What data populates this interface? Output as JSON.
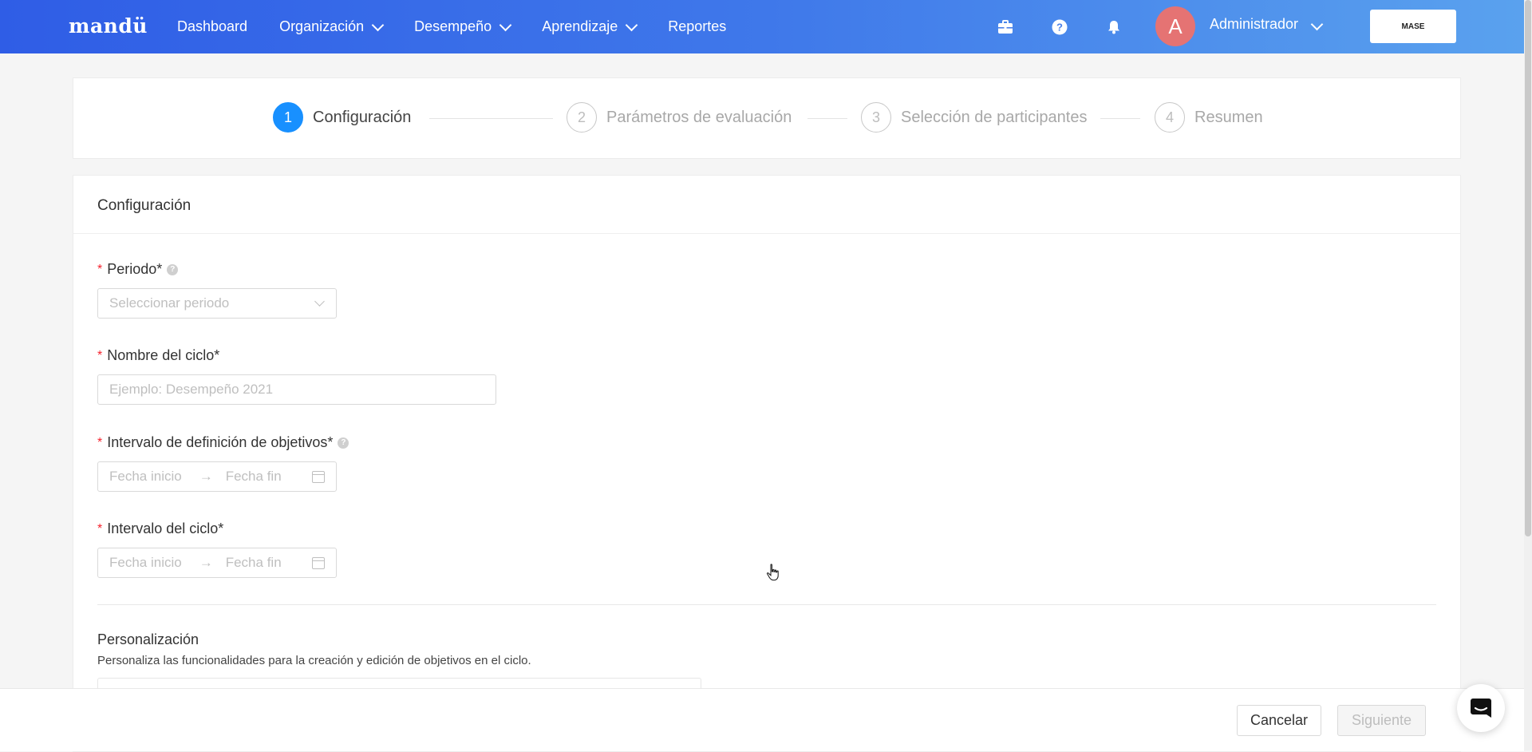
{
  "app": {
    "logo": "mandü",
    "company_logo": "MASE"
  },
  "nav": {
    "items": [
      {
        "label": "Dashboard",
        "has_dropdown": false
      },
      {
        "label": "Organización",
        "has_dropdown": true
      },
      {
        "label": "Desempeño",
        "has_dropdown": true
      },
      {
        "label": "Aprendizaje",
        "has_dropdown": true
      },
      {
        "label": "Reportes",
        "has_dropdown": false
      }
    ],
    "icons": [
      "briefcase-icon",
      "help-icon",
      "bell-icon"
    ],
    "user": {
      "initial": "A",
      "name": "Administrador"
    }
  },
  "steps": [
    {
      "number": "1",
      "label": "Configuración",
      "active": true
    },
    {
      "number": "2",
      "label": "Parámetros de evaluación",
      "active": false
    },
    {
      "number": "3",
      "label": "Selección de participantes",
      "active": false
    },
    {
      "number": "4",
      "label": "Resumen",
      "active": false
    }
  ],
  "form": {
    "title": "Configuración",
    "period": {
      "label": "Periodo*",
      "placeholder": "Seleccionar periodo"
    },
    "cycle_name": {
      "label": "Nombre del ciclo*",
      "placeholder": "Ejemplo: Desempeño 2021"
    },
    "objectives_interval": {
      "label": "Intervalo de definición de objetivos*",
      "start_placeholder": "Fecha inicio",
      "end_placeholder": "Fecha fin"
    },
    "cycle_interval": {
      "label": "Intervalo del ciclo*",
      "start_placeholder": "Fecha inicio",
      "end_placeholder": "Fecha fin"
    },
    "customization": {
      "title": "Personalización",
      "description": "Personaliza las funcionalidades para la creación y edición de objetivos en el ciclo."
    }
  },
  "footer": {
    "cancel_label": "Cancelar",
    "next_label": "Siguiente"
  },
  "colors": {
    "primary": "#1890ff",
    "required": "#f5222d",
    "header_start": "#2f5de6",
    "header_end": "#5aa2ee"
  }
}
